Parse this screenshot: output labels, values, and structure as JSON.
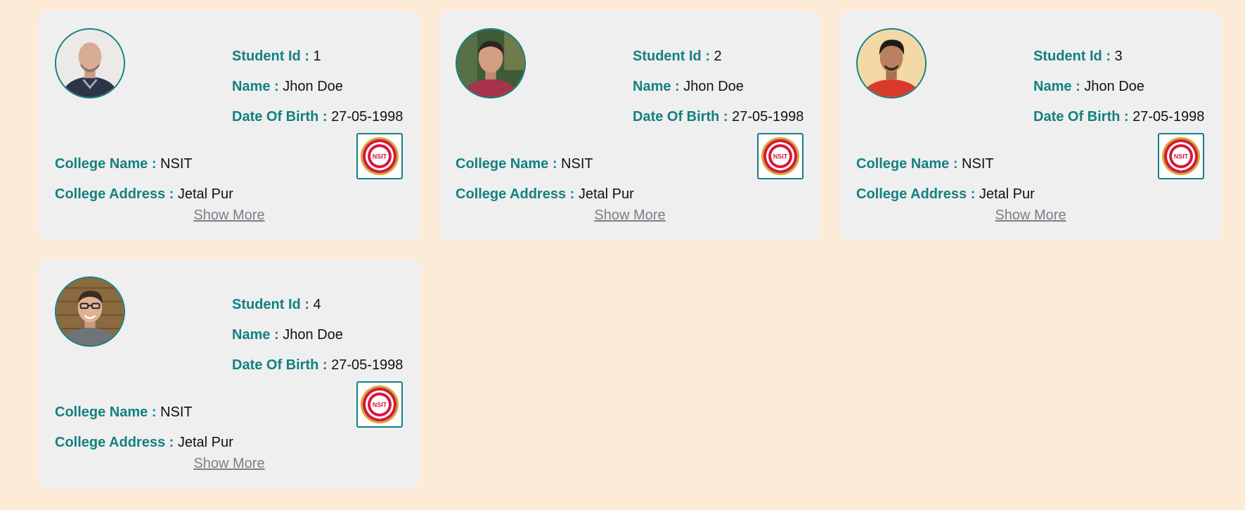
{
  "labels": {
    "student_id": "Student Id :",
    "name": "Name :",
    "dob": "Date Of Birth :",
    "college_name": "College Name :",
    "college_address": "College Address :",
    "show_more": "Show More",
    "logo_text": "NSIT"
  },
  "students": [
    {
      "id": "1",
      "name": "Jhon Doe",
      "dob": "27-05-1998",
      "college_name": "NSIT",
      "college_address": "Jetal Pur",
      "avatar_icon": "student-photo-bald-man"
    },
    {
      "id": "2",
      "name": "Jhon Doe",
      "dob": "27-05-1998",
      "college_name": "NSIT",
      "college_address": "Jetal Pur",
      "avatar_icon": "student-photo-man-maroon-shirt"
    },
    {
      "id": "3",
      "name": "Jhon Doe",
      "dob": "27-05-1998",
      "college_name": "NSIT",
      "college_address": "Jetal Pur",
      "avatar_icon": "student-photo-man-red-shirt"
    },
    {
      "id": "4",
      "name": "Jhon Doe",
      "dob": "27-05-1998",
      "college_name": "NSIT",
      "college_address": "Jetal Pur",
      "avatar_icon": "student-photo-man-glasses"
    }
  ],
  "colors": {
    "page_background": "#fcebd6",
    "card_background": "#efefef",
    "label_color": "#148080",
    "link_color": "#7b7f87",
    "logo_red": "#d7193a",
    "logo_gold": "#d8a93b"
  }
}
